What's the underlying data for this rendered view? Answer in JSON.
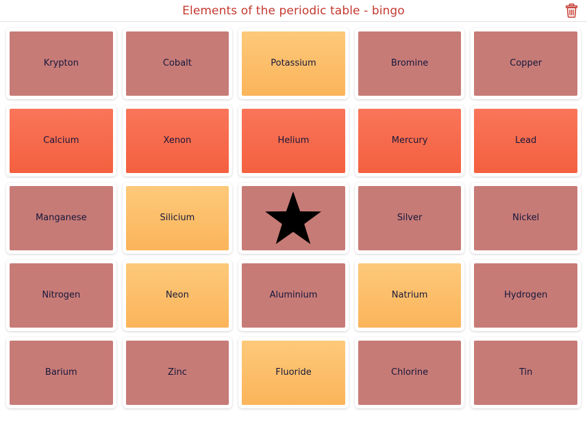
{
  "header": {
    "title": "Elements of the periodic table - bingo",
    "delete_icon": "trash-icon",
    "title_color": "#c4392f",
    "border_color": "#e2e2e2"
  },
  "palette": {
    "rose": "#c77b77",
    "amber": "#fbb85f",
    "salmon": "#f5643f",
    "card_background": "#ffffff",
    "label_color": "#16173a",
    "star_color": "#000000"
  },
  "board": {
    "columns": 5,
    "rows": 5,
    "free_space_icon": "star-icon",
    "cells": [
      {
        "label": "Krypton",
        "color": "rose",
        "state": "unmarked"
      },
      {
        "label": "Cobalt",
        "color": "rose",
        "state": "unmarked"
      },
      {
        "label": "Potassium",
        "color": "amber",
        "state": "marked"
      },
      {
        "label": "Bromine",
        "color": "rose",
        "state": "unmarked"
      },
      {
        "label": "Copper",
        "color": "rose",
        "state": "unmarked"
      },
      {
        "label": "Calcium",
        "color": "salmon",
        "state": "highlighted"
      },
      {
        "label": "Xenon",
        "color": "salmon",
        "state": "highlighted"
      },
      {
        "label": "Helium",
        "color": "salmon",
        "state": "highlighted"
      },
      {
        "label": "Mercury",
        "color": "salmon",
        "state": "highlighted"
      },
      {
        "label": "Lead",
        "color": "salmon",
        "state": "highlighted"
      },
      {
        "label": "Manganese",
        "color": "rose",
        "state": "unmarked"
      },
      {
        "label": "Silicium",
        "color": "amber",
        "state": "marked"
      },
      {
        "label": "",
        "color": "rose",
        "state": "free",
        "icon": "star-icon"
      },
      {
        "label": "Silver",
        "color": "rose",
        "state": "unmarked"
      },
      {
        "label": "Nickel",
        "color": "rose",
        "state": "unmarked"
      },
      {
        "label": "Nitrogen",
        "color": "rose",
        "state": "unmarked"
      },
      {
        "label": "Neon",
        "color": "amber",
        "state": "marked"
      },
      {
        "label": "Aluminium",
        "color": "rose",
        "state": "unmarked"
      },
      {
        "label": "Natrium",
        "color": "amber",
        "state": "marked"
      },
      {
        "label": "Hydrogen",
        "color": "rose",
        "state": "unmarked"
      },
      {
        "label": "Barium",
        "color": "rose",
        "state": "unmarked"
      },
      {
        "label": "Zinc",
        "color": "rose",
        "state": "unmarked"
      },
      {
        "label": "Fluoride",
        "color": "amber",
        "state": "marked"
      },
      {
        "label": "Chlorine",
        "color": "rose",
        "state": "unmarked"
      },
      {
        "label": "Tin",
        "color": "rose",
        "state": "unmarked"
      }
    ]
  }
}
